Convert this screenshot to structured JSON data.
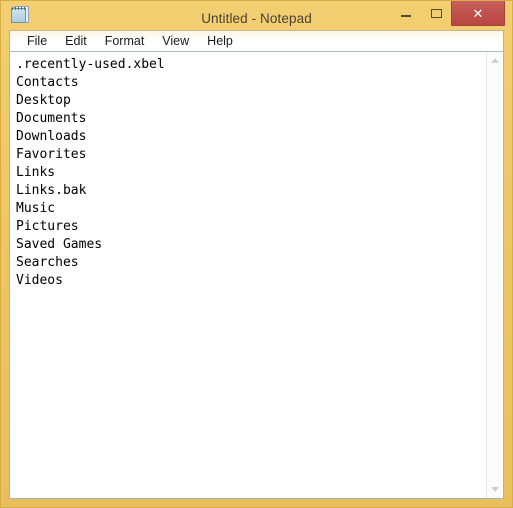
{
  "window": {
    "title": "Untitled - Notepad",
    "app_icon": "notepad-icon",
    "frame_color": "#eec766",
    "close_color": "#bf514d"
  },
  "controls": {
    "minimize_label": "–",
    "maximize_label": "□",
    "close_label": "✕"
  },
  "menubar": {
    "items": [
      {
        "label": "File"
      },
      {
        "label": "Edit"
      },
      {
        "label": "Format"
      },
      {
        "label": "View"
      },
      {
        "label": "Help"
      }
    ]
  },
  "editor": {
    "lines": [
      ".recently-used.xbel",
      "Contacts",
      "Desktop",
      "Documents",
      "Downloads",
      "Favorites",
      "Links",
      "Links.bak",
      "Music",
      "Pictures",
      "Saved Games",
      "Searches",
      "Videos"
    ],
    "text_color": "#000000"
  },
  "scrollbar": {
    "up_arrow": "scroll-up-arrow",
    "down_arrow": "scroll-down-arrow"
  }
}
